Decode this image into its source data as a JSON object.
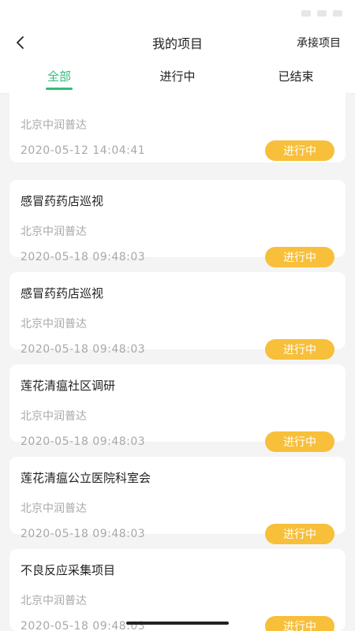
{
  "header": {
    "title": "我的项目",
    "right_link": "承接项目"
  },
  "tabs": [
    {
      "label": "全部",
      "active": true
    },
    {
      "label": "进行中",
      "active": false
    },
    {
      "label": "已结束",
      "active": false
    }
  ],
  "cards": [
    {
      "name": "",
      "org": "北京中润普达",
      "time": "2020-05-12 14:04:41",
      "status": "进行中"
    },
    {
      "name": "感冒药药店巡视",
      "org": "北京中润普达",
      "time": "2020-05-18 09:48:03",
      "status": "进行中"
    },
    {
      "name": "感冒药药店巡视",
      "org": "北京中润普达",
      "time": "2020-05-18 09:48:03",
      "status": "进行中"
    },
    {
      "name": "莲花清瘟社区调研",
      "org": "北京中润普达",
      "time": "2020-05-18 09:48:03",
      "status": "进行中"
    },
    {
      "name": "莲花清瘟公立医院科室会",
      "org": "北京中润普达",
      "time": "2020-05-18 09:48:03",
      "status": "进行中"
    },
    {
      "name": "不良反应采集项目",
      "org": "北京中润普达",
      "time": "2020-05-18 09:48:03",
      "status": "进行中"
    }
  ],
  "colors": {
    "accent_green": "#2bbf7d",
    "status_yellow": "#f7bf3a",
    "background": "#f4f4f4"
  }
}
